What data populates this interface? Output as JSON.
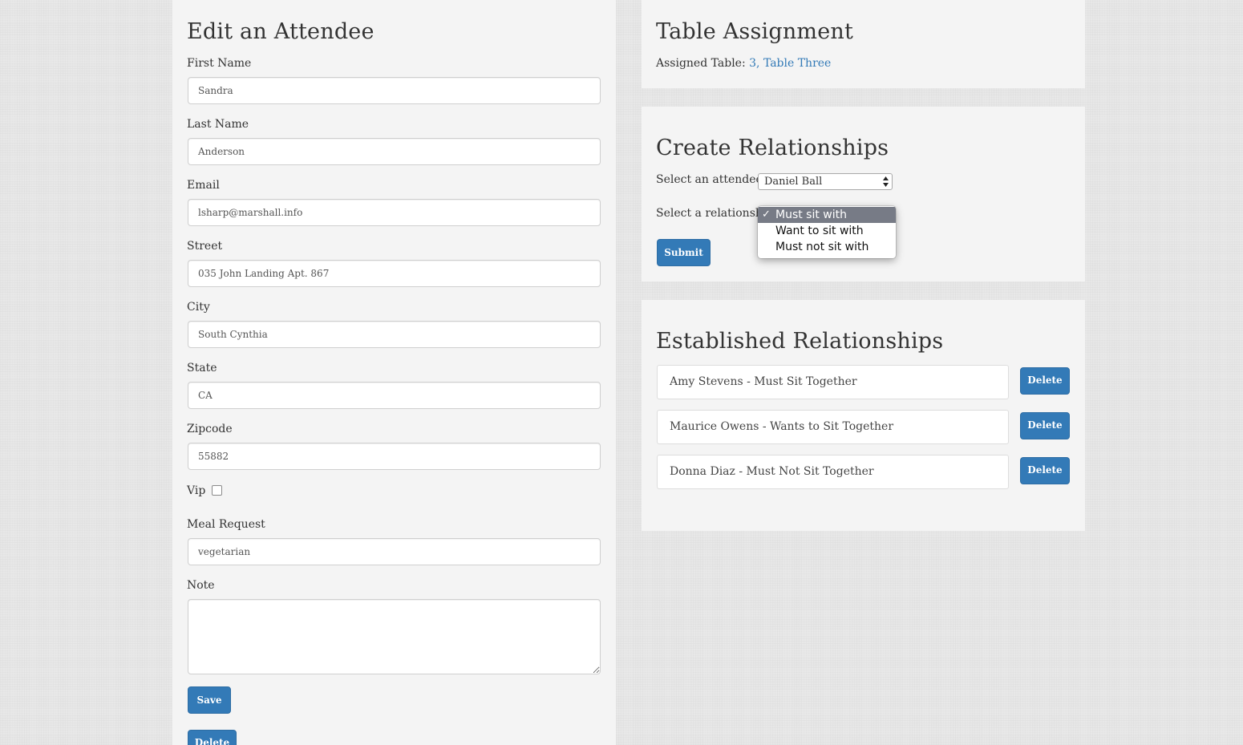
{
  "edit": {
    "title": "Edit an Attendee",
    "fields": [
      {
        "label": "First Name",
        "value": "Sandra"
      },
      {
        "label": "Last Name",
        "value": "Anderson"
      },
      {
        "label": "Email",
        "value": "lsharp@marshall.info"
      },
      {
        "label": "Street",
        "value": "035 John Landing Apt. 867"
      },
      {
        "label": "City",
        "value": "South Cynthia"
      },
      {
        "label": "State",
        "value": "CA"
      },
      {
        "label": "Zipcode",
        "value": "55882"
      }
    ],
    "vip_label": "Vip",
    "vip_checked": false,
    "meal_label": "Meal Request",
    "meal_value": "vegetarian",
    "note_label": "Note",
    "note_value": "",
    "save_label": "Save",
    "delete_label": "Delete"
  },
  "table_assignment": {
    "title": "Table Assignment",
    "label": "Assigned Table:",
    "number": "3,",
    "name": "Table Three"
  },
  "create": {
    "title": "Create Relationships",
    "attendee_label": "Select an attendee",
    "attendee_value": "Daniel Ball",
    "relationship_label": "Select a relationship",
    "options": [
      "Must sit with",
      "Want to sit with",
      "Must not sit with"
    ],
    "selected_option": "Must sit with",
    "check_mark": "✓",
    "submit_label": "Submit"
  },
  "established": {
    "title": "Established Relationships",
    "items": [
      {
        "text": "Amy Stevens - Must Sit Together",
        "delete_label": "Delete"
      },
      {
        "text": "Maurice Owens - Wants to Sit Together",
        "delete_label": "Delete"
      },
      {
        "text": "Donna Diaz - Must Not Sit Together",
        "delete_label": "Delete"
      }
    ]
  },
  "colors": {
    "primary": "#337ab7",
    "panel": "#f4f4f4",
    "background": "#e8e8e8",
    "dropdown_selected": "#777b86"
  }
}
